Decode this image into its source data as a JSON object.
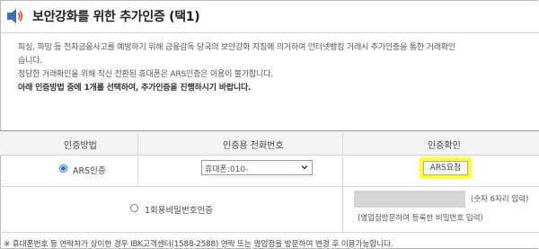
{
  "header": {
    "title": "보안강화를 위한 추가인증 (택1)",
    "icon": "speaker-icon",
    "accent_color": "#e8412c"
  },
  "notice": {
    "line1": "피싱, 파밍 등 전자금융사고를 예방하기 위해 금융감독 당국의 보안강화 지침에 의거하여 인터넷뱅킹 거래시 추가인증을 통한 거래확인",
    "line2": "습니다.",
    "line3": "정당한 거래확인을 위해 착신 전환된 휴대폰은 ARS인증은 이용이 불가합니다.",
    "line4": "아래 인증방법 중에 1개를 선택하여, 추가인증을 진행하시기 바랍니다."
  },
  "table": {
    "headers": [
      "인증방법",
      "인증용 전화번호",
      "인증확인"
    ],
    "ars": {
      "label": "ARS인증",
      "selected": true,
      "phone_select_value": "휴대폰:010-",
      "button_label": "ARS요청",
      "highlight_color": "#ffff2a"
    },
    "otp": {
      "label": "1회용비밀번호인증",
      "selected": false,
      "input_value": "",
      "hint": "(숫자 6자리 입력)",
      "hint2": "(영업점방문하여 등록한 비밀번호 입력)"
    }
  },
  "footer": {
    "note": "※ 휴대폰번호 등 연락처가 상이한 경우 IBK고객센터(1588-2588) 연락 또는 영업점을 방문하여 변경 후 이용가능합니다."
  }
}
